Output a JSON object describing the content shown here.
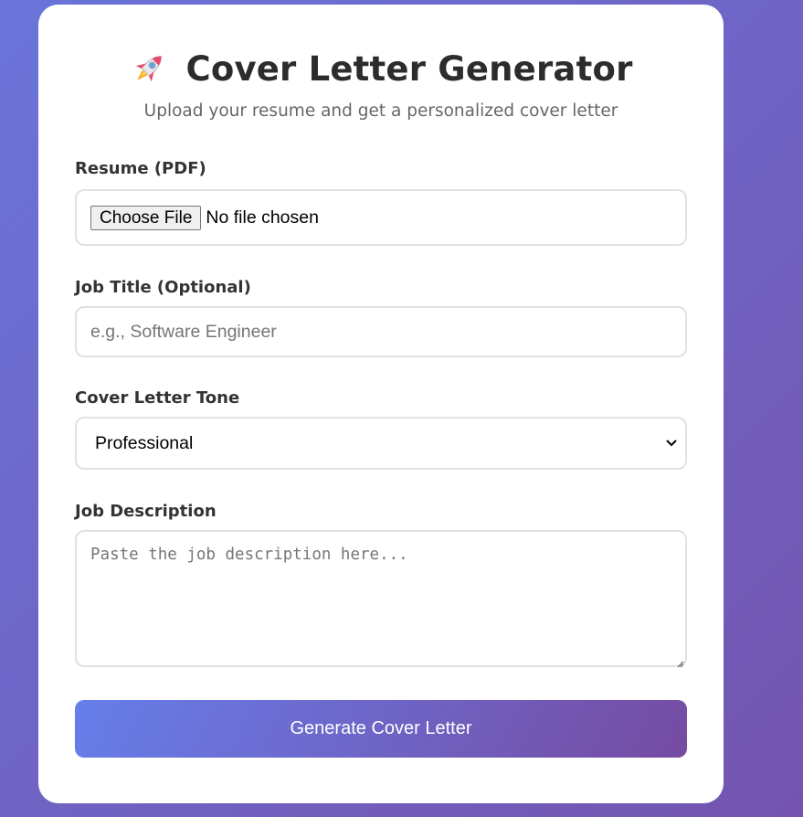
{
  "header": {
    "icon": "rocket-icon",
    "title": "Cover Letter Generator",
    "subtitle": "Upload your resume and get a personalized cover letter"
  },
  "resume": {
    "label": "Resume (PDF)",
    "button_label": "Choose File",
    "status": "No file chosen"
  },
  "job_title": {
    "label": "Job Title (Optional)",
    "value": "",
    "placeholder": "e.g., Software Engineer"
  },
  "tone": {
    "label": "Cover Letter Tone",
    "selected": "Professional"
  },
  "job_description": {
    "label": "Job Description",
    "value": "",
    "placeholder": "Paste the job description here..."
  },
  "submit": {
    "label": "Generate Cover Letter"
  },
  "colors": {
    "gradient_start": "#667eea",
    "gradient_end": "#764ba2",
    "title_text": "#2c2c2c",
    "subtitle_text": "#666666"
  }
}
